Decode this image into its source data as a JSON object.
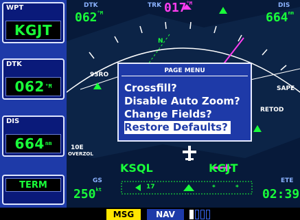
{
  "left_panel": {
    "wpt": {
      "label": "WPT",
      "value": "KGJT"
    },
    "dtk": {
      "label": "DTK",
      "value": "062",
      "unit": "°M"
    },
    "dis": {
      "label": "DIS",
      "value": "664",
      "unit": "nm"
    },
    "term": {
      "value": "TERM"
    }
  },
  "header": {
    "dtk": {
      "label": "DTK",
      "value": "062",
      "unit": "°M"
    },
    "trk": {
      "label": "TRK",
      "value": "017",
      "unit": "°M"
    },
    "dis": {
      "label": "DIS",
      "value": "664",
      "unit": "nm"
    }
  },
  "footer": {
    "gs": {
      "label": "GS",
      "value": "250",
      "unit": "kt"
    },
    "ete": {
      "label": "ETE",
      "value": "02:39"
    }
  },
  "map": {
    "north_marker": "N",
    "from_waypoint": "KSQL",
    "to_waypoint": "KGJT",
    "label_left": "93RO",
    "label_right_top": "SAPE",
    "label_right_mid": "RETOD",
    "label_lower_left": "10E",
    "label_lower_left_sub": "OVERZOL",
    "zoom_text": "17",
    "zoom_dot": "*",
    "zoom_dot_2": "*"
  },
  "page_menu": {
    "title": "PAGE MENU",
    "items": [
      {
        "label": "Crossfill?"
      },
      {
        "label": "Disable Auto Zoom?"
      },
      {
        "label": "Change Fields?"
      },
      {
        "label": "Restore Defaults?",
        "selected": true
      }
    ]
  },
  "status_bar": {
    "msg": "MSG",
    "nav": "NAV",
    "signal_bars_filled": 1,
    "signal_bars_total": 4
  },
  "colors": {
    "panel_blue": "#1e3aa8",
    "value_green": "#19ff3a",
    "track_magenta": "#ff3df0",
    "msg_yellow": "#ffe600"
  }
}
